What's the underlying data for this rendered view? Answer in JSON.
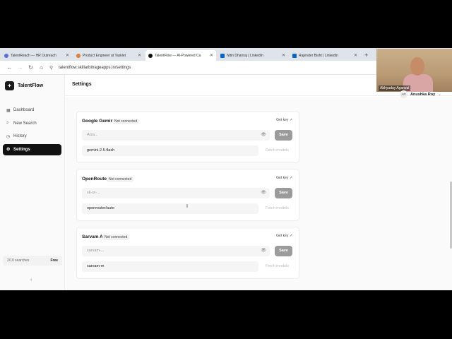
{
  "browser": {
    "tabs": [
      {
        "label": "TalentReach — HR Outreach",
        "color": "#5a6fd8",
        "active": false
      },
      {
        "label": "Product Engineer at Tasklet",
        "color": "#e07b39",
        "active": false
      },
      {
        "label": "TalentFlow — AI-Powered Ca",
        "color": "#111111",
        "active": true
      },
      {
        "label": "Nitin Dhanraj | LinkedIn",
        "color": "#0a66c2",
        "active": false
      },
      {
        "label": "Rajender Bisht | LinkedIn",
        "color": "#0a66c2",
        "active": false
      }
    ],
    "url": "talentflow.skillarbitrageapps.in/settings"
  },
  "app": {
    "brand": "TalentFlow",
    "page_title": "Settings",
    "nav": [
      {
        "label": "Dashboard",
        "icon": "dashboard-icon",
        "glyph": "▦"
      },
      {
        "label": "New Search",
        "icon": "search-icon",
        "glyph": "⌕"
      },
      {
        "label": "History",
        "icon": "history-icon",
        "glyph": "◷"
      },
      {
        "label": "Settings",
        "icon": "gear-icon",
        "glyph": "⚙",
        "active": true
      }
    ],
    "usage": {
      "count": "2/10 searches",
      "plan": "Free"
    },
    "user": {
      "initials": "AR",
      "name": "Anushka Roy"
    }
  },
  "webcam": {
    "name": "Abhyuday Agarwal"
  },
  "providers": [
    {
      "name": "Google Gemini",
      "status": "Not connected",
      "get_key": "Get key",
      "key_placeholder": "AIza...",
      "save": "Save",
      "model": "gemini-2.5-flash",
      "fetch": "Fetch models"
    },
    {
      "name": "OpenRouter",
      "status": "Not connected",
      "get_key": "Get key",
      "key_placeholder": "sk-or-...",
      "save": "Save",
      "model": "openrouter/auto",
      "fetch": "Fetch models"
    },
    {
      "name": "Sarvam AI",
      "status": "Not connected",
      "get_key": "Get key",
      "key_placeholder": "sarvam-...",
      "save": "Save",
      "model": "sarvam-m",
      "fetch": "Fetch models"
    }
  ]
}
